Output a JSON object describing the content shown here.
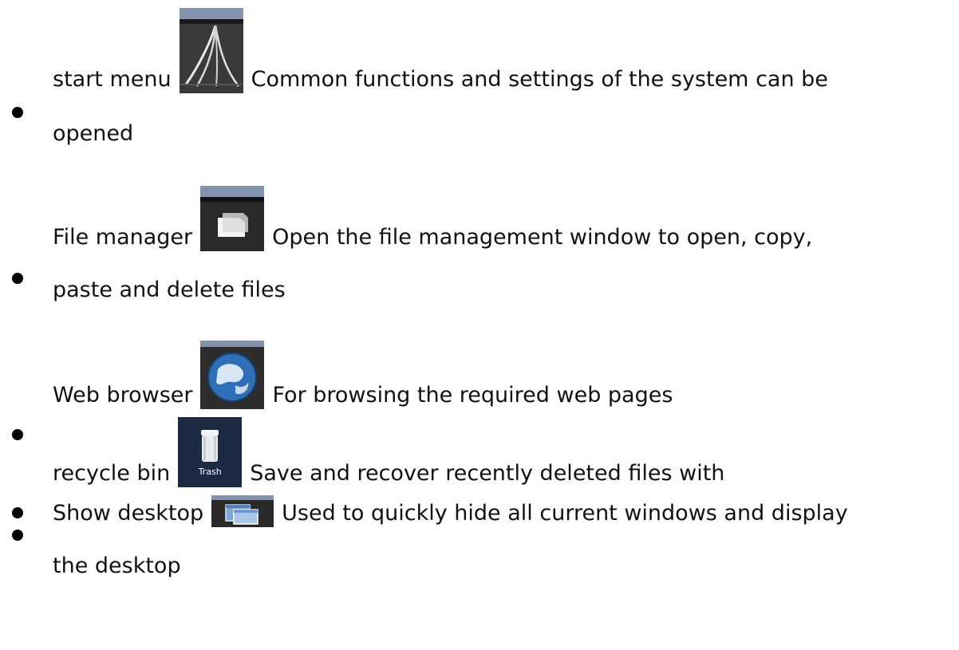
{
  "items": [
    {
      "label": "start menu",
      "icon": "start-menu-icon",
      "description_line1": "Common functions and settings of the system can be",
      "description_line2": "opened"
    },
    {
      "label": "File manager",
      "icon": "file-manager-icon",
      "description_line1": "Open the file management window to open, copy,",
      "description_line2": "paste and delete files"
    },
    {
      "label": "Web browser",
      "icon": "web-browser-icon",
      "description_line1": "For browsing the required web pages"
    },
    {
      "label": "recycle bin",
      "icon": "trash-icon",
      "icon_caption": "Trash",
      "description_line1": "Save and recover recently deleted files with"
    },
    {
      "label": "Show desktop",
      "icon": "show-desktop-icon",
      "description_line1": "Used to quickly hide all current windows and display",
      "description_line2": "the desktop"
    }
  ],
  "colors": {
    "text": "#111111",
    "bullet": "#000000",
    "icon_top_bar": "#8090a8",
    "icon_dark": "#2a2a2a",
    "trash_bg": "#1c2a44"
  }
}
